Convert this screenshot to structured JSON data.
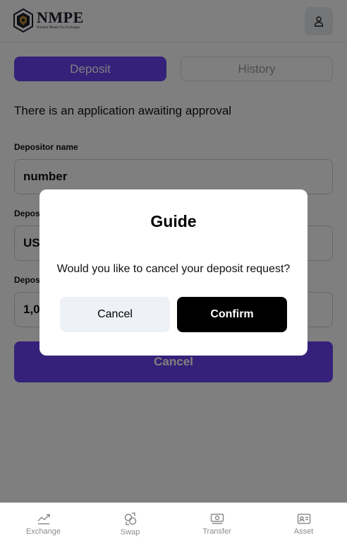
{
  "header": {
    "logo_title": "NMPE",
    "logo_subtitle": "Number Money For Exchange",
    "profile_icon": "user-icon"
  },
  "tabs": [
    {
      "label": "Deposit",
      "active": true
    },
    {
      "label": "History",
      "active": false
    }
  ],
  "notice": "There is an application awaiting approval",
  "form": {
    "depositor_name_label": "Depositor name",
    "depositor_name_value": "number",
    "field2_label": "Depos",
    "field2_value": "US",
    "field3_label": "Depos",
    "field3_value": "1,0",
    "cancel_label": "Cancel"
  },
  "modal": {
    "title": "Guide",
    "message": "Would you like to cancel your deposit request?",
    "cancel_label": "Cancel",
    "confirm_label": "Confirm"
  },
  "bottom_nav": [
    {
      "label": "Exchange",
      "icon": "trend-icon"
    },
    {
      "label": "Swap",
      "icon": "swap-icon"
    },
    {
      "label": "Transfer",
      "icon": "banknote-icon"
    },
    {
      "label": "Asset",
      "icon": "id-card-icon"
    }
  ],
  "colors": {
    "accent": "#6a43f2",
    "confirm": "#000000",
    "overlay": "rgba(0,0,0,0.5)"
  }
}
